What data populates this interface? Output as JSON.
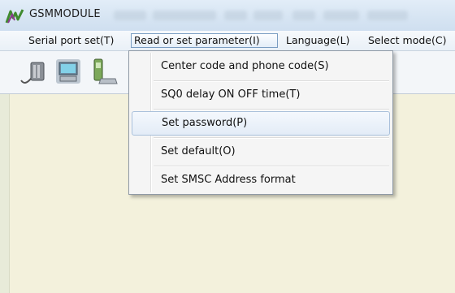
{
  "window": {
    "title": "GSMMODULE"
  },
  "menubar": {
    "items": [
      {
        "label": "Serial port set(T)"
      },
      {
        "label": "Read or set parameter(I)"
      },
      {
        "label": "Language(L)"
      },
      {
        "label": "Select mode(C)"
      }
    ]
  },
  "toolbar": {
    "buttons": [
      {
        "icon": "serial-cable-icon"
      },
      {
        "icon": "computer-icon"
      },
      {
        "icon": "phone-icon"
      }
    ]
  },
  "dropdown": {
    "items": [
      {
        "label": "Center code and phone code(S)"
      },
      {
        "label": "SQ0 delay ON OFF time(T)"
      },
      {
        "label": "Set password(P)"
      },
      {
        "label": "Set default(O)"
      },
      {
        "label": "Set SMSC Address format"
      }
    ],
    "highlighted": "Set password(P)"
  },
  "colors": {
    "titlebar": "#d7e5f3",
    "menubar": "#eef3f8",
    "client_background": "#f3f1dc",
    "menu_highlight_border": "#a9c0db"
  }
}
